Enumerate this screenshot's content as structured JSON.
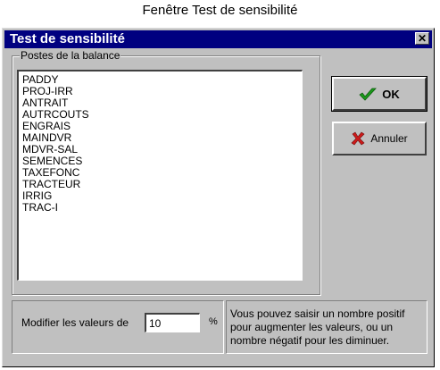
{
  "caption": "Fenêtre Test de sensibilité",
  "window": {
    "title": "Test de sensibilité",
    "close_symbol": "✕"
  },
  "group": {
    "label": "Postes de la balance",
    "items": [
      "PADDY",
      "PROJ-IRR",
      "ANTRAIT",
      "AUTRCOUTS",
      "ENGRAIS",
      "MAINDVR",
      "MDVR-SAL",
      "SEMENCES",
      "TAXEFONC",
      "TRACTEUR",
      "IRRIG",
      "TRAC-I"
    ]
  },
  "buttons": {
    "ok_label": "OK",
    "cancel_label": "Annuler"
  },
  "modifier": {
    "label": "Modifier les valeurs de",
    "value": "10",
    "unit": "%"
  },
  "help": {
    "text": "Vous pouvez saisir un nombre positif pour augmenter les valeurs, ou un nombre négatif pour les diminuer."
  },
  "colors": {
    "titlebar": "#000080",
    "ok_check": "#1a9a1a",
    "cancel_x": "#cc1a1a"
  },
  "icons": {
    "ok": "checkmark-icon",
    "cancel": "x-icon"
  }
}
